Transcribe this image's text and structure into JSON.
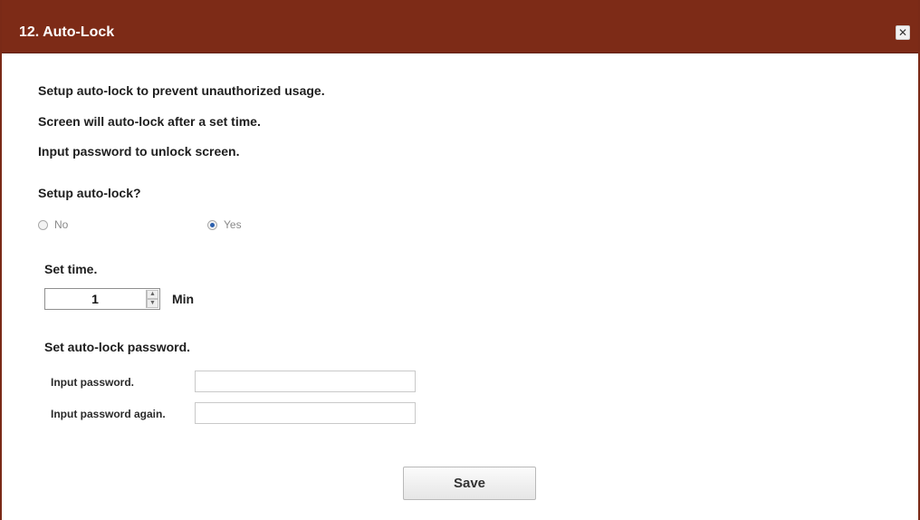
{
  "dialog": {
    "title": "12. Auto-Lock",
    "close_icon": "close-icon",
    "colors": {
      "titlebar": "#7d2b17",
      "title_text": "#ffffff"
    }
  },
  "description": {
    "line1": "Setup auto-lock to prevent unauthorized usage.",
    "line2": "Screen will auto-lock after a set time.",
    "line3": "Input password to unlock screen."
  },
  "setup": {
    "question": "Setup auto-lock?",
    "options": [
      {
        "label": "No",
        "checked": false
      },
      {
        "label": "Yes",
        "checked": true
      }
    ]
  },
  "time": {
    "label": "Set time.",
    "value": "1",
    "unit": "Min",
    "up_icon": "arrow-up-icon",
    "down_icon": "arrow-down-icon"
  },
  "password": {
    "heading": "Set auto-lock password.",
    "input_label": "Input password.",
    "input_value": "",
    "again_label": "Input password again.",
    "again_value": ""
  },
  "actions": {
    "save_label": "Save"
  }
}
